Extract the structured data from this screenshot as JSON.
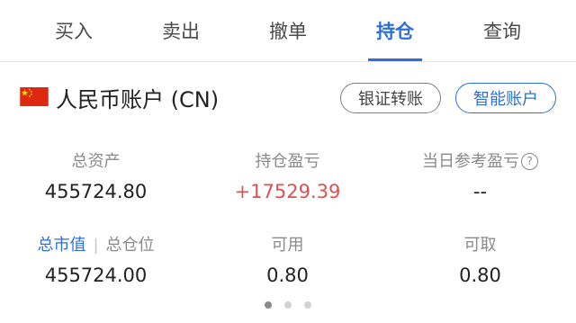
{
  "tabs": [
    {
      "label": "买入",
      "active": false
    },
    {
      "label": "卖出",
      "active": false
    },
    {
      "label": "撤单",
      "active": false
    },
    {
      "label": "持仓",
      "active": true
    },
    {
      "label": "查询",
      "active": false
    }
  ],
  "account": {
    "flag_icon": "china-flag-icon",
    "title": "人民币账户 (CN)",
    "transfer_button": "银证转账",
    "smart_button": "智能账户"
  },
  "summary": {
    "total_assets": {
      "label": "总资产",
      "value": "455724.80"
    },
    "position_pnl": {
      "label": "持仓盈亏",
      "value": "+17529.39"
    },
    "today_pnl": {
      "label": "当日参考盈亏",
      "value": "--",
      "help_icon": "question-circle-icon"
    },
    "market_value": {
      "label": "总市值",
      "alt_label": "总仓位",
      "value": "455724.00"
    },
    "available": {
      "label": "可用",
      "value": "0.80"
    },
    "withdrawable": {
      "label": "可取",
      "value": "0.80"
    }
  },
  "pager": {
    "count": 3,
    "active_index": 0
  },
  "colors": {
    "accent": "#2d6fd8",
    "gain": "#e0504c",
    "muted": "#8a8a8a"
  }
}
